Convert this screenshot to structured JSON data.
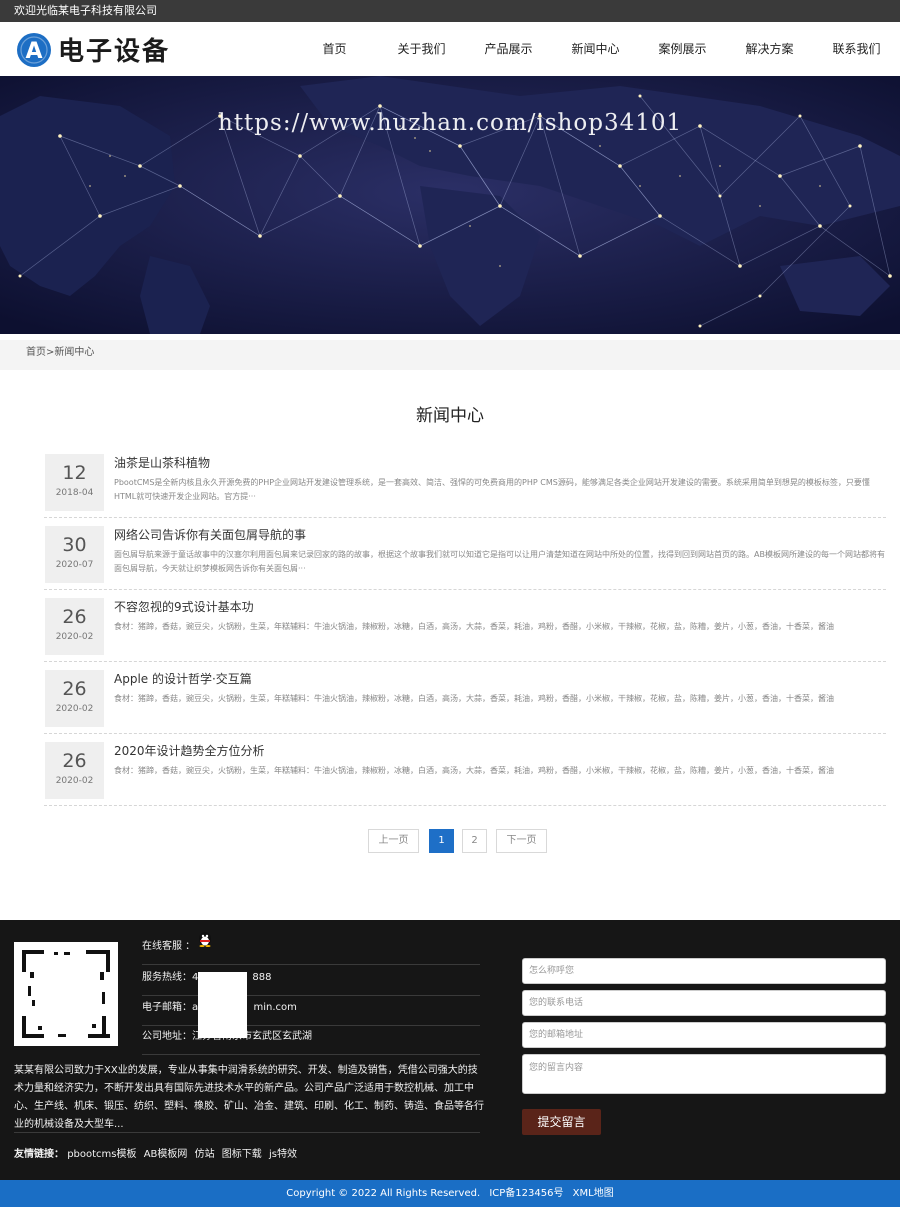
{
  "topbar": {
    "welcome": "欢迎光临某电子科技有限公司"
  },
  "header": {
    "logo_letter": "A",
    "logo_text": "电子设备",
    "nav": [
      "首页",
      "关于我们",
      "产品展示",
      "新闻中心",
      "案例展示",
      "解决方案",
      "联系我们"
    ]
  },
  "banner": {
    "watermark": "https://www.huzhan.com/ishop34101"
  },
  "breadcrumb": {
    "home": "首页",
    "sep": ">",
    "current": "新闻中心"
  },
  "section": {
    "title": "新闻中心"
  },
  "news": [
    {
      "day": "12",
      "ym": "2018-04",
      "title": "油茶是山茶科植物",
      "desc": "PbootCMS是全新内核且永久开源免费的PHP企业网站开发建设管理系统，是一套高效、简洁、强悍的可免费商用的PHP CMS源码，能够满足各类企业网站开发建设的需要。系统采用简单到想晃的模板标签，只要懂HTML就可快速开发企业网站。官方提···"
    },
    {
      "day": "30",
      "ym": "2020-07",
      "title": "网络公司告诉你有关面包屑导航的事",
      "desc": "面包屑导航来源于童话故事中的汉塞尔利用面包屑来记录回家的路的故事，根据这个故事我们就可以知道它是指可以让用户清楚知道在网站中所处的位置，找得到回到网站首页的路。AB模板网所建设的每一个网站都将有面包屑导航，今天就让织梦模板网告诉你有关面包屑···"
    },
    {
      "day": "26",
      "ym": "2020-02",
      "title": "不容忽视的9式设计基本功",
      "desc": "食材：猪蹄，香菇，豌豆尖，火锅粉，生菜，年糕辅料：牛油火锅油，辣椒粉，冰糖，白酒，高汤，大蒜，香菜，耗油，鸡粉，香醋，小米椒，干辣椒，花椒，盐，陈糟，姜片，小葱，香油，十香菜，酱油"
    },
    {
      "day": "26",
      "ym": "2020-02",
      "title": "Apple 的设计哲学·交互篇",
      "desc": "食材：猪蹄，香菇，豌豆尖，火锅粉，生菜，年糕辅料：牛油火锅油，辣椒粉，冰糖，白酒，高汤，大蒜，香菜，耗油，鸡粉，香醋，小米椒，干辣椒，花椒，盐，陈糟，姜片，小葱，香油，十香菜，酱油"
    },
    {
      "day": "26",
      "ym": "2020-02",
      "title": "2020年设计趋势全方位分析",
      "desc": "食材：猪蹄，香菇，豌豆尖，火锅粉，生菜，年糕辅料：牛油火锅油，辣椒粉，冰糖，白酒，高汤，大蒜，香菜，耗油，鸡粉，香醋，小米椒，干辣椒，花椒，盐，陈糟，姜片，小葱，香油，十香菜，酱油"
    }
  ],
  "pager": {
    "prev": "上一页",
    "page1": "1",
    "page2": "2",
    "next": "下一页",
    "current": 1
  },
  "footer": {
    "online_label": "在线客服 ：",
    "hotline": "服务热线：4",
    "hotline_tail": "888",
    "email": "电子邮箱：ad",
    "email_tail": "min.com",
    "address": "公司地址：江苏省南京市玄武区玄武湖",
    "about": "某某有限公司致力于XX业的发展，专业从事集中润滑系统的研究、开发、制造及销售，凭借公司强大的技术力量和经济实力，不断开发出具有国际先进技术水平的新产品。公司产品广泛适用于数控机械、加工中心、生产线、机床、锻压、纺织、塑料、橡胶、矿山、冶金、建筑、印刷、化工、制药、铸造、食品等各行业的机械设备及大型车...",
    "links_label": "友情链接：",
    "links": [
      "pbootcms模板",
      "AB模板网",
      "仿站",
      "图标下载",
      "js特效"
    ],
    "form": {
      "name_placeholder": "怎么称呼您",
      "phone_placeholder": "您的联系电话",
      "email_placeholder": "您的邮箱地址",
      "message_placeholder": "您的留言内容",
      "submit": "提交留言"
    },
    "copyright": "Copyright © 2022 All Rights Reserved.",
    "icp": "ICP备123456号",
    "sitemap": "XML地图"
  },
  "colors": {
    "accent": "#1e6fc7",
    "footer_bg": "#161616",
    "submit": "#5a2419",
    "logo_blue": "#1d6ec4"
  }
}
